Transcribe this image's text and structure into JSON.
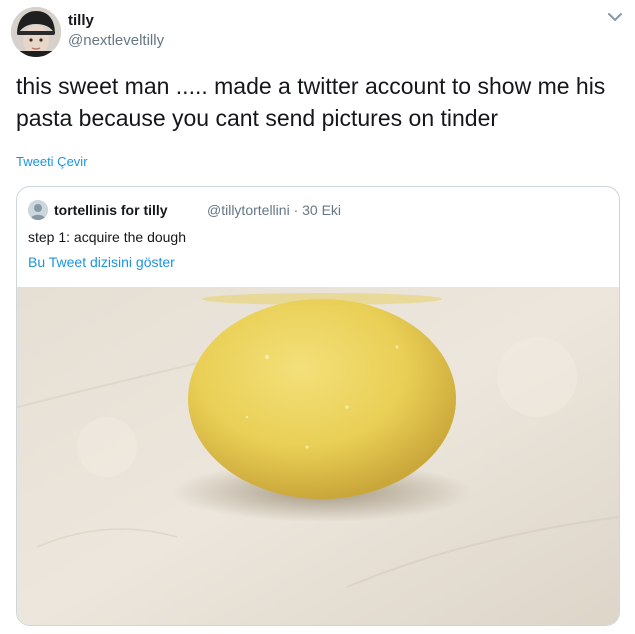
{
  "tweet": {
    "display_name": "tilly",
    "handle": "@nextleveltilly",
    "text": "this sweet man ..... made a twitter account to show me his pasta because you cant send pictures on tinder",
    "translate_label": "Tweeti Çevir",
    "avatar_icon": "profile-avatar-icon",
    "caret_icon": "chevron-down-icon"
  },
  "quoted": {
    "display_name": "tortellinis for tilly",
    "handle_date": "@tillytortellini · 30 Eki",
    "text": "step 1: acquire the dough",
    "thread_label": "Bu Tweet dizisini göster",
    "image_description": "photo-dough-ball"
  },
  "colors": {
    "link": "#1b95e0",
    "secondary_text": "#657786",
    "border": "#ccd6dd"
  }
}
